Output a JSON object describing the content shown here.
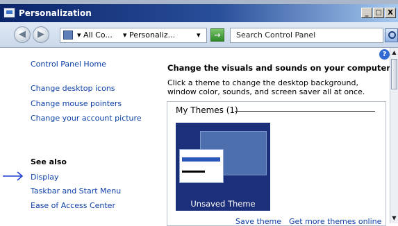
{
  "window": {
    "title": "Personalization",
    "minimize_label": "_",
    "maximize_label": "□",
    "close_label": "X"
  },
  "toolbar": {
    "back_glyph": "◀",
    "forward_glyph": "▶",
    "breadcrumb": [
      "▾ All Co...",
      "▾ Personaliz...",
      "▾"
    ],
    "go_glyph": "→",
    "search_placeholder": "Search Control Panel"
  },
  "sidebar": {
    "links": [
      "Control Panel Home",
      "Change desktop icons",
      "Change mouse pointers",
      "Change your account picture"
    ],
    "see_also_title": "See also",
    "see_also_links": [
      "Display",
      "Taskbar and Start Menu",
      "Ease of Access Center"
    ]
  },
  "main": {
    "help_glyph": "?",
    "heading": "Change the visuals and sounds on your computer",
    "description": "Click a theme to change the desktop background, window color, sounds, and screen saver all at once.",
    "themes_group_label": "My Themes (1)",
    "theme_name": "Unsaved Theme",
    "save_theme_link": "Save theme",
    "get_more_link": "Get more themes online"
  },
  "scrollbar": {
    "up_glyph": "▲",
    "down_glyph": "▼"
  },
  "colors": {
    "titlebar_start": "#0a246a",
    "titlebar_end": "#a6caf0",
    "link": "#0b3fa8",
    "theme_background": "#1c2f7a",
    "annotation_arrow": "#1a3fd0"
  }
}
